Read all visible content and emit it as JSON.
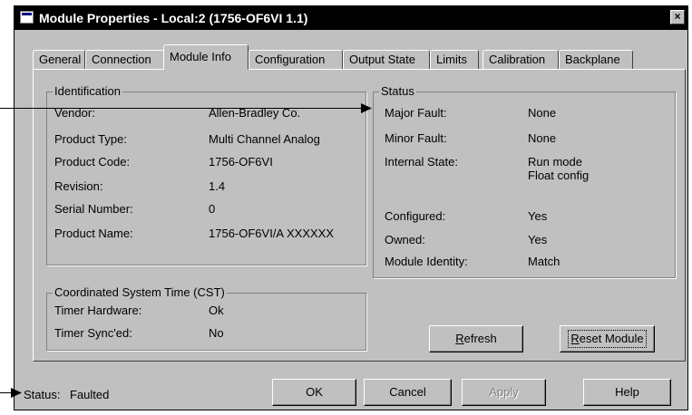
{
  "window": {
    "title": "Module Properties - Local:2 (1756-OF6VI 1.1)",
    "close_glyph": "×"
  },
  "tabs": [
    {
      "label": "General"
    },
    {
      "label": "Connection"
    },
    {
      "label": "Module Info",
      "active": true
    },
    {
      "label": "Configuration"
    },
    {
      "label": "Output State"
    },
    {
      "label": "Limits"
    },
    {
      "label": "Calibration"
    },
    {
      "label": "Backplane"
    }
  ],
  "identification": {
    "title": "Identification",
    "rows": [
      {
        "label": "Vendor:",
        "value": "Allen-Bradley Co."
      },
      {
        "label": "Product Type:",
        "value": "Multi Channel Analog"
      },
      {
        "label": "Product Code:",
        "value": "1756-OF6VI"
      },
      {
        "label": "Revision:",
        "value": "1.4"
      },
      {
        "label": "Serial Number:",
        "value": "0"
      },
      {
        "label": "Product Name:",
        "value": "1756-OF6VI/A XXXXXX"
      }
    ]
  },
  "cst": {
    "title": "Coordinated System Time (CST)",
    "rows": [
      {
        "label": "Timer Hardware:",
        "value": "Ok"
      },
      {
        "label": "Timer Sync'ed:",
        "value": "No"
      }
    ]
  },
  "status_group": {
    "title": "Status",
    "rows": [
      {
        "label": "Major Fault:",
        "value": "None"
      },
      {
        "label": "Minor Fault:",
        "value": "None"
      },
      {
        "label": "Internal State:",
        "value": "Run mode",
        "value2": "Float config"
      },
      {
        "label": "Configured:",
        "value": "Yes"
      },
      {
        "label": "Owned:",
        "value": "Yes"
      },
      {
        "label": "Module Identity:",
        "value": "Match"
      }
    ]
  },
  "buttons": {
    "refresh": {
      "pre": "",
      "u": "R",
      "post": "efresh"
    },
    "reset": {
      "pre": "",
      "u": "R",
      "post": "eset Module"
    },
    "ok": "OK",
    "cancel": "Cancel",
    "apply": "Apply",
    "help": "Help"
  },
  "footer": {
    "status_label": "Status:",
    "status_value": "Faulted"
  }
}
